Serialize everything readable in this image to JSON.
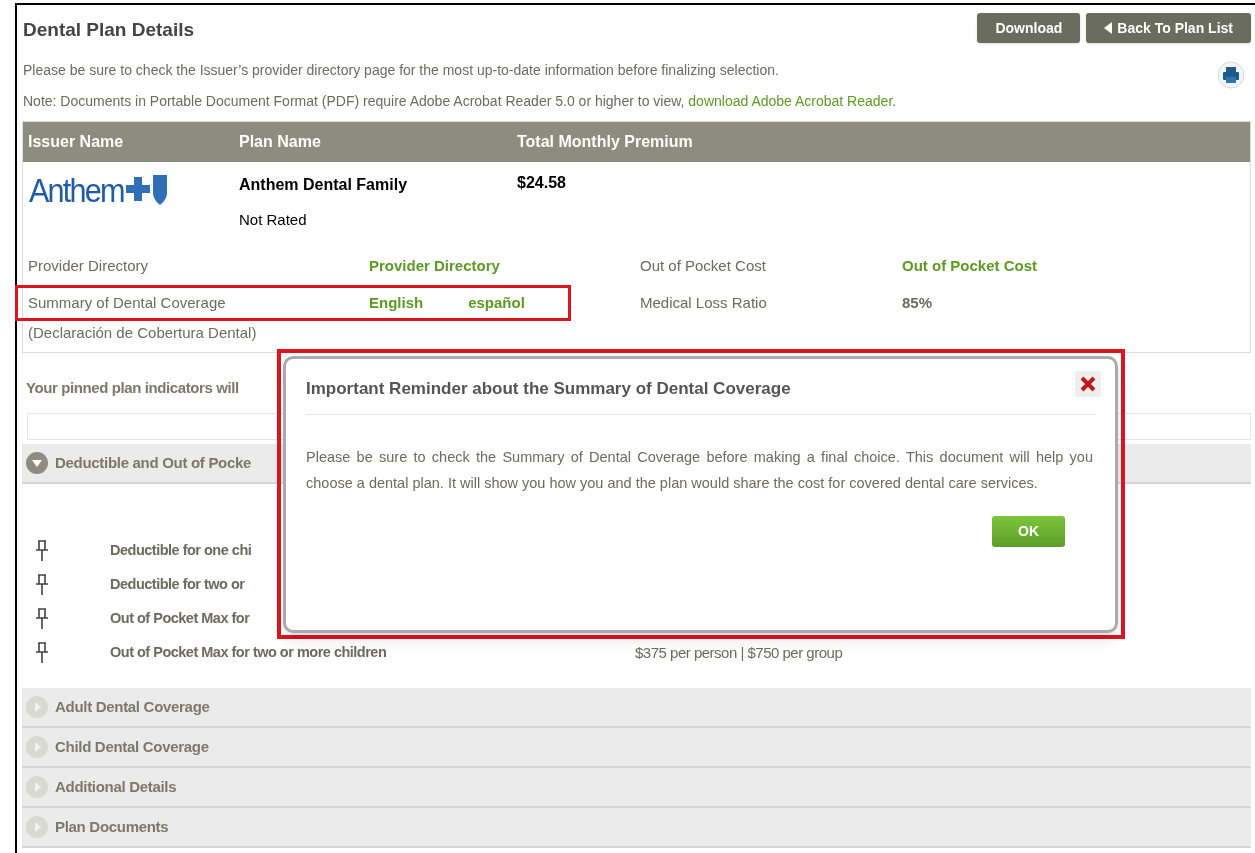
{
  "page": {
    "title": "Dental Plan Details",
    "buttons": [
      {
        "kind": "plain",
        "label": "Download"
      },
      {
        "kind": "back",
        "label": "Back To Plan List"
      }
    ],
    "notice": "Please be sure to check the Issuer’s provider directory page for the most up-to-date information before finalizing selection.",
    "pdf_note": {
      "text": "Note: Documents in Portable Document Format (PDF) require Adobe Acrobat Reader 5.0 or higher to view,",
      "link": "download Adobe Acrobat Reader",
      "end": "."
    }
  },
  "plan_table": {
    "columns": [
      "Issuer Name",
      "Plan Name",
      "Total Monthly Premium"
    ],
    "issuer_logo": "Anthem",
    "plan_name": "Anthem Dental Family",
    "rating": "Not Rated",
    "premium": "$24.58",
    "details": [
      {
        "label": "Provider Directory",
        "links": [
          "Provider Directory"
        ],
        "label2": "Out of Pocket Cost",
        "value2": {
          "kind": "link",
          "text": "Out of Pocket Cost"
        },
        "highlighted": false
      },
      {
        "label": "Summary of Dental Coverage",
        "links": [
          "English",
          "español"
        ],
        "label2": "Medical Loss Ratio",
        "value2": {
          "kind": "text",
          "text": "85%"
        },
        "highlighted": true
      }
    ],
    "translation_note": "(Declaración de Cobertura Dental)"
  },
  "pinned_note": "Your pinned plan indicators will",
  "sections": [
    {
      "title": "Deductible and Out of Pocke",
      "expanded": true,
      "rows": [
        {
          "label": "Deductible for one chi"
        },
        {
          "label": "Deductible for two or"
        },
        {
          "label": "Out of Pocket Max for"
        },
        {
          "label": "Out of Pocket Max for two or more children",
          "value": "$375 per person | $750 per group"
        }
      ]
    },
    {
      "title": "Adult Dental Coverage",
      "expanded": false
    },
    {
      "title": "Child Dental Coverage",
      "expanded": false
    },
    {
      "title": "Additional Details",
      "expanded": false
    },
    {
      "title": "Plan Documents",
      "expanded": false
    }
  ],
  "dialog": {
    "title": "Important Reminder about the Summary of Dental Coverage",
    "body": "Please be sure to check the Summary of Dental Coverage before making a final choice. This document will help you choose a dental plan. It will show you how you and the plan would share the cost for covered dental care services.",
    "button": "OK",
    "highlighted": true
  }
}
